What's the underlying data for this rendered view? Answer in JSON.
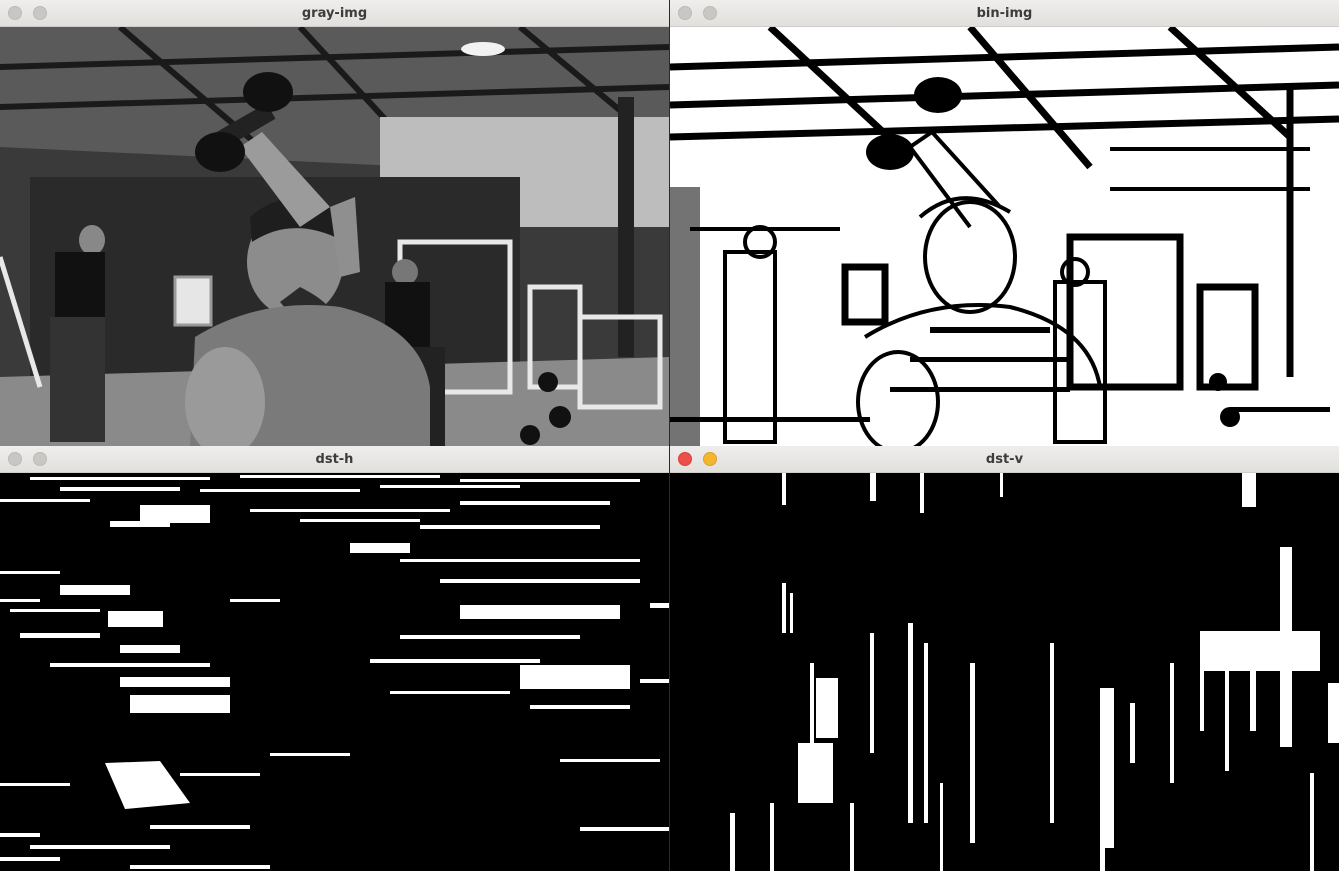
{
  "windows": [
    {
      "id": "gray",
      "title": "gray-img",
      "focused": false,
      "content_icon": "grayscale-photo"
    },
    {
      "id": "bin",
      "title": "bin-img",
      "focused": false,
      "content_icon": "binary-threshold-image"
    },
    {
      "id": "dsth",
      "title": "dst-h",
      "focused": false,
      "content_icon": "horizontal-lines-image"
    },
    {
      "id": "dstv",
      "title": "dst-v",
      "focused": true,
      "content_icon": "vertical-lines-image"
    }
  ],
  "colors": {
    "titlebar": "#e6e4e1",
    "close_active": "#ed4f4a",
    "minimize_active": "#f5b62f",
    "button_inactive": "#c9c7c4"
  }
}
